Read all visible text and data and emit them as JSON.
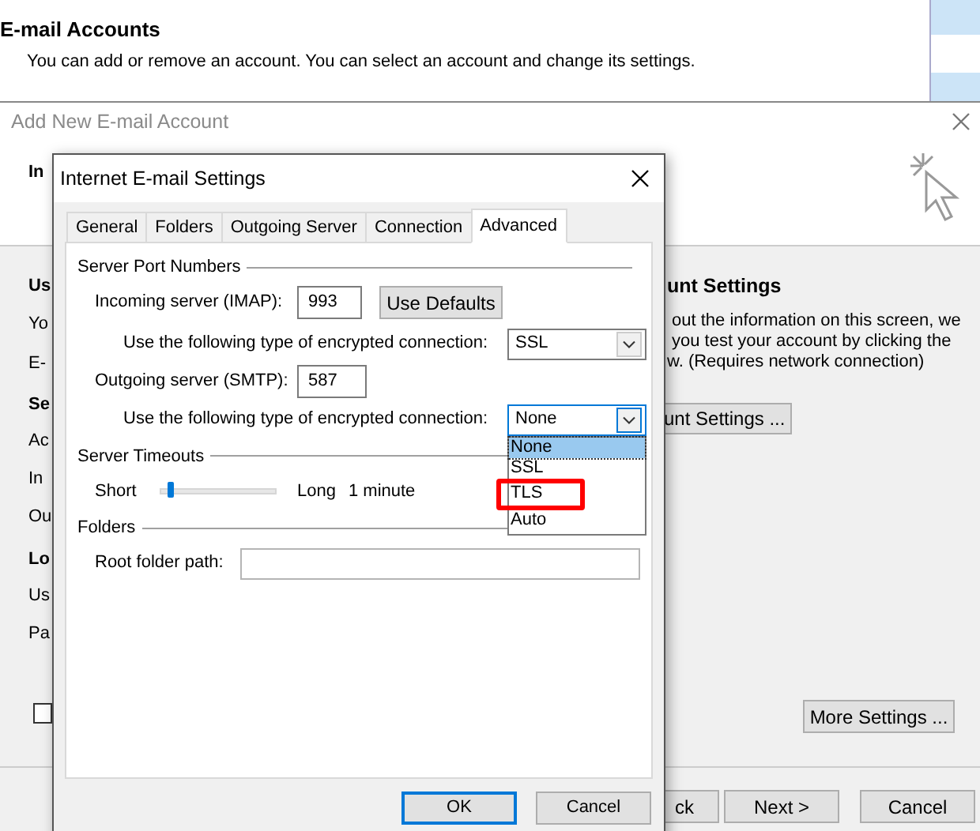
{
  "background_window": {
    "title": "E-mail Accounts",
    "subtitle": "You can add or remove an account. You can select an account and change its settings."
  },
  "add_account_window": {
    "title": "Add New E-mail Account",
    "left_labels": [
      {
        "text": "In",
        "bold": true
      },
      {
        "text": "Us",
        "bold": true
      },
      {
        "text": "Yo",
        "bold": false
      },
      {
        "text": "E-",
        "bold": false
      },
      {
        "text": "Se",
        "bold": true
      },
      {
        "text": "Ac",
        "bold": false
      },
      {
        "text": "In",
        "bold": false
      },
      {
        "text": "Ou",
        "bold": false
      },
      {
        "text": "Lo",
        "bold": true
      },
      {
        "text": "Us",
        "bold": false
      },
      {
        "text": "Pa",
        "bold": false
      }
    ],
    "remember_checked": false,
    "right_heading": "unt Settings",
    "right_lines": [
      "out the information on this screen, we",
      "you test your account by clicking the",
      "w. (Requires network connection)"
    ],
    "test_button": "unt Settings ...",
    "more_settings_button": "More Settings ...",
    "footer_buttons": [
      "ck",
      "Next >",
      "Cancel"
    ]
  },
  "dialog": {
    "title": "Internet E-mail Settings",
    "tabs": [
      {
        "label": "General",
        "selected": false
      },
      {
        "label": "Folders",
        "selected": false
      },
      {
        "label": "Outgoing Server",
        "selected": false
      },
      {
        "label": "Connection",
        "selected": false
      },
      {
        "label": "Advanced",
        "selected": true
      }
    ],
    "server_ports": {
      "heading": "Server Port Numbers",
      "incoming_label": "Incoming server (IMAP):",
      "incoming_value": "993",
      "defaults_button": "Use Defaults",
      "incoming_encryption_label": "Use the following type of encrypted connection:",
      "incoming_encryption": "SSL",
      "outgoing_label": "Outgoing server (SMTP):",
      "outgoing_value": "587",
      "outgoing_encryption_label": "Use the following type of encrypted connection:",
      "outgoing_encryption": "None",
      "outgoing_options": [
        {
          "label": "None",
          "selected": true,
          "annotated": false
        },
        {
          "label": "SSL",
          "selected": false,
          "annotated": false
        },
        {
          "label": "TLS",
          "selected": false,
          "annotated": true
        },
        {
          "label": "Auto",
          "selected": false,
          "annotated": false
        }
      ]
    },
    "timeouts": {
      "heading": "Server Timeouts",
      "short_label": "Short",
      "level": 0.05,
      "long_label": "Long",
      "reading": "1 minute"
    },
    "folders": {
      "heading": "Folders",
      "root_label": "Root folder path:"
    },
    "buttons": [
      {
        "label": "OK",
        "default": true
      },
      {
        "label": "Cancel",
        "default": false
      }
    ]
  }
}
